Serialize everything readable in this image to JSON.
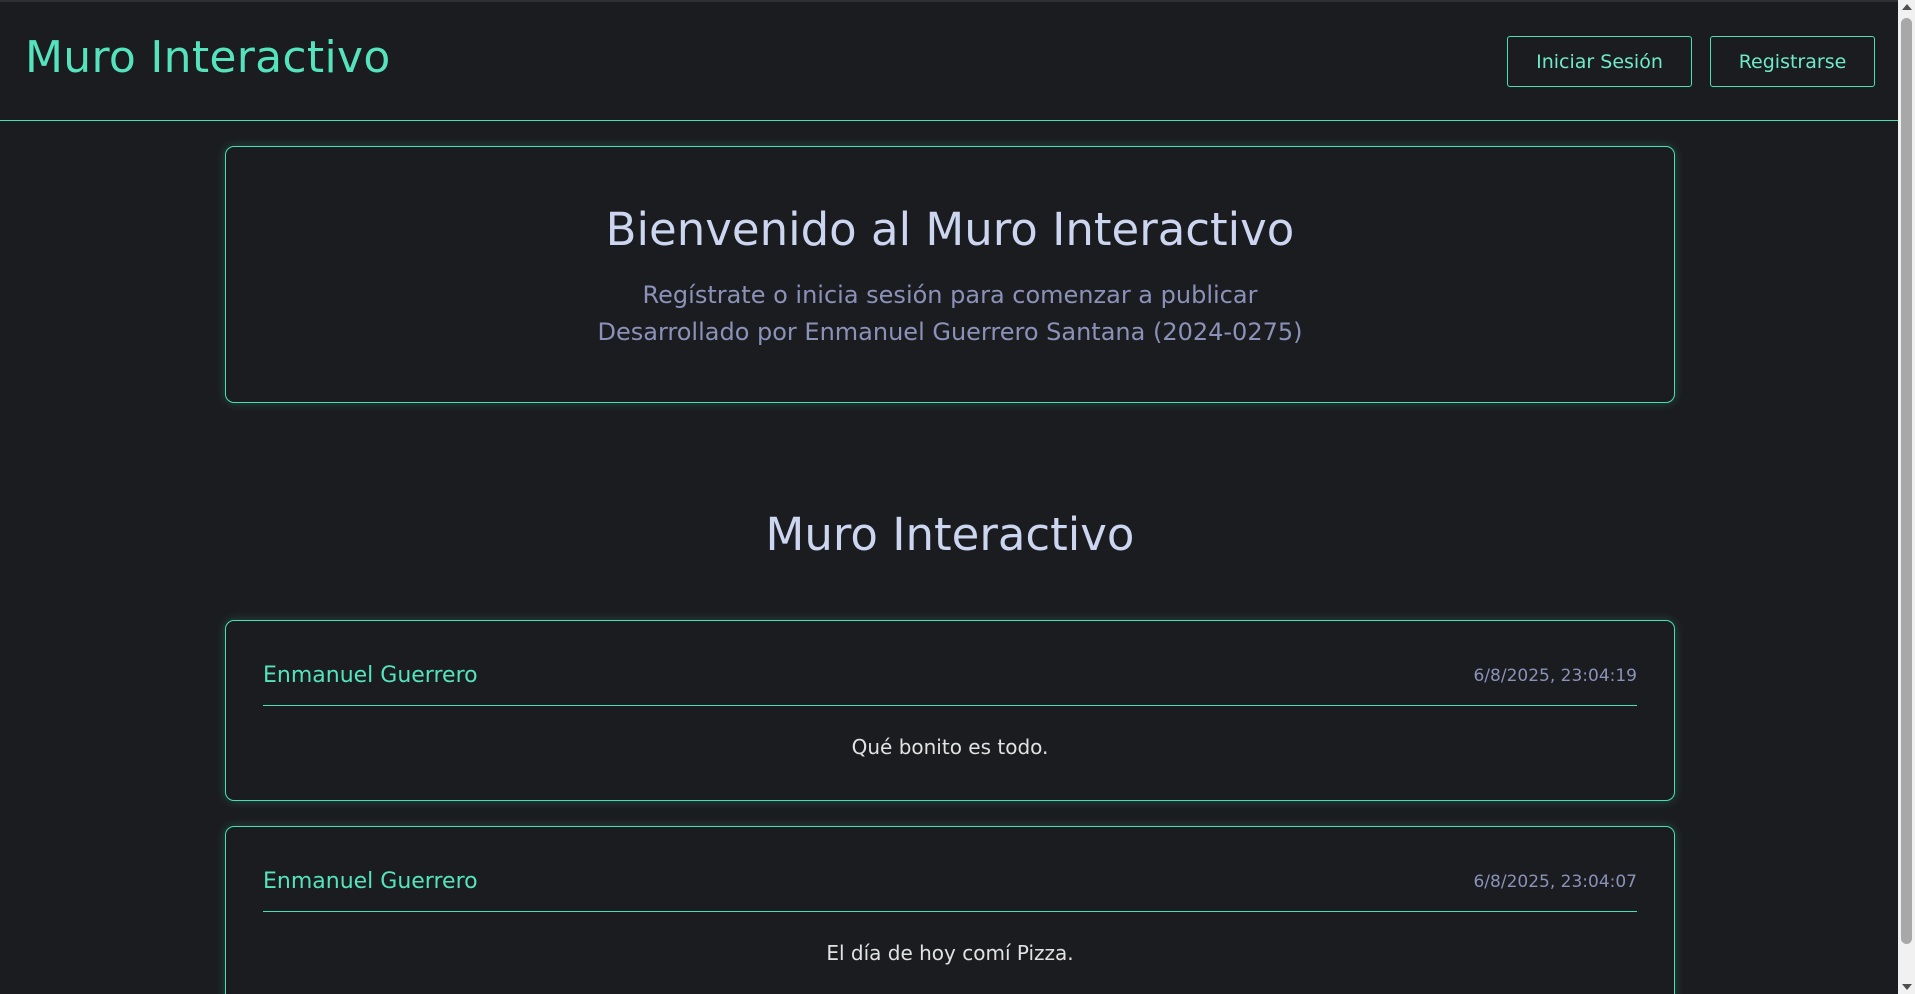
{
  "header": {
    "brand": "Muro Interactivo",
    "login_label": "Iniciar Sesión",
    "register_label": "Registrarse"
  },
  "welcome": {
    "title": "Bienvenido al Muro Interactivo",
    "subtitle": "Regístrate o inicia sesión para comenzar a publicar",
    "credit": "Desarrollado por Enmanuel Guerrero Santana (2024-0275)"
  },
  "wall": {
    "title": "Muro Interactivo",
    "posts": [
      {
        "author": "Enmanuel Guerrero",
        "timestamp": "6/8/2025, 23:04:19",
        "content": "Qué bonito es todo."
      },
      {
        "author": "Enmanuel Guerrero",
        "timestamp": "6/8/2025, 23:04:07",
        "content": "El día de hoy comí Pizza."
      }
    ]
  },
  "colors": {
    "accent": "#46e0b4",
    "background": "#1b1c1f",
    "heading": "#cdd6f1",
    "muted": "#8b91b8"
  }
}
